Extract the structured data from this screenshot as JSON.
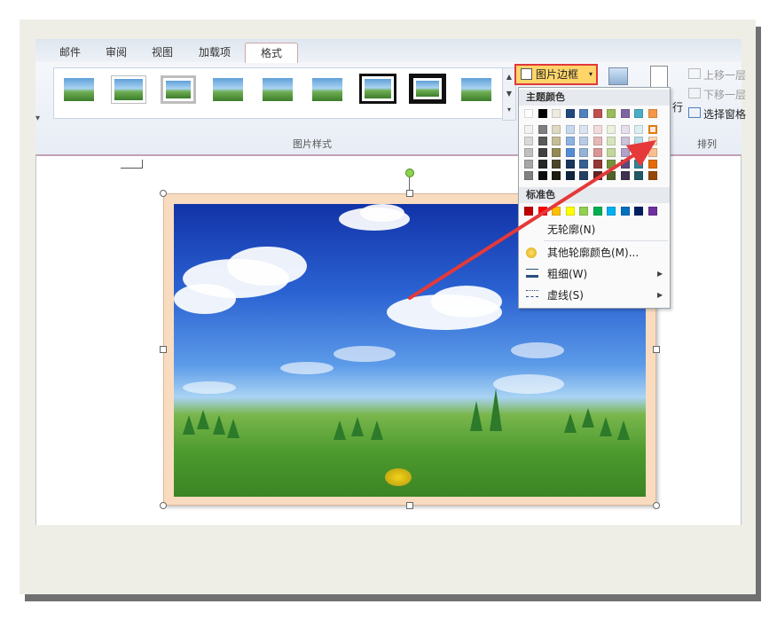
{
  "ribbon": {
    "tabs": [
      "邮件",
      "审阅",
      "视图",
      "加载项",
      "格式"
    ],
    "active_tab": "格式",
    "picture_styles_label": "图片样式",
    "border_button_label": "图片边框",
    "arrange_label": "排列",
    "bring_forward": "上移一层",
    "send_backward": "下移一层",
    "selection_pane": "选择窗格",
    "wrap_partial": "行"
  },
  "dropdown": {
    "theme_colors_label": "主题颜色",
    "standard_colors_label": "标准色",
    "no_outline": "无轮廓(N)",
    "more_colors": "其他轮廓颜色(M)...",
    "weight": "粗细(W)",
    "dashes": "虚线(S)",
    "theme_top_row": [
      "#ffffff",
      "#000000",
      "#eeece1",
      "#1f497d",
      "#4f81bd",
      "#c0504d",
      "#9bbb59",
      "#8064a2",
      "#4bacc6",
      "#f79646"
    ],
    "theme_shades": [
      [
        "#f2f2f2",
        "#d9d9d9",
        "#bfbfbf",
        "#a6a6a6",
        "#808080"
      ],
      [
        "#7f7f7f",
        "#595959",
        "#404040",
        "#262626",
        "#0d0d0d"
      ],
      [
        "#ddd9c3",
        "#c4bd97",
        "#948a54",
        "#4a452a",
        "#1e1c11"
      ],
      [
        "#c6d9f0",
        "#8db3e2",
        "#548dd4",
        "#17365d",
        "#0f243e"
      ],
      [
        "#dbe5f1",
        "#b8cce4",
        "#95b3d7",
        "#366092",
        "#244061"
      ],
      [
        "#f2dcdb",
        "#e5b9b7",
        "#d99694",
        "#953734",
        "#632423"
      ],
      [
        "#ebf1dd",
        "#d7e3bc",
        "#c3d69b",
        "#76923c",
        "#4f6128"
      ],
      [
        "#e5e0ec",
        "#ccc1d9",
        "#b2a2c7",
        "#5f497a",
        "#3f3151"
      ],
      [
        "#dbeef3",
        "#b7dde8",
        "#92cddc",
        "#31859b",
        "#205867"
      ],
      [
        "#fdeada",
        "#fbd5b5",
        "#fac08f",
        "#e36c09",
        "#974806"
      ]
    ],
    "standard_colors": [
      "#c00000",
      "#ff0000",
      "#ffc000",
      "#ffff00",
      "#92d050",
      "#00b050",
      "#00b0f0",
      "#0070c0",
      "#002060",
      "#7030a0"
    ]
  },
  "colors": {
    "picture_border": "#f9dcc0",
    "highlight_box": "#e0393a",
    "arrow": "#e5393a"
  }
}
